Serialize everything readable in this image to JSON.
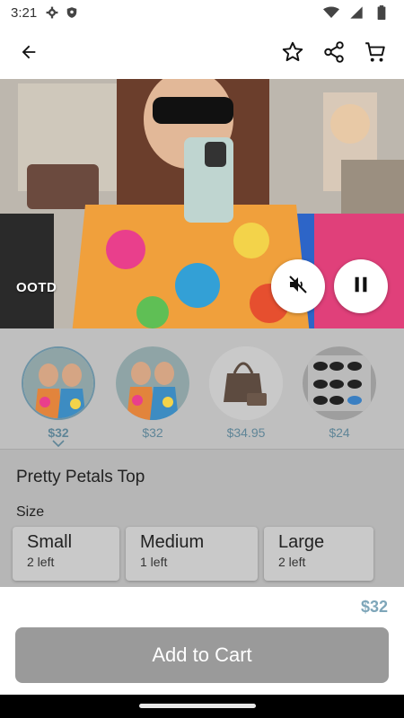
{
  "status_bar": {
    "time": "3:21"
  },
  "icons": {
    "back": "arrow-left-icon",
    "favorite": "star-outline-icon",
    "share": "share-icon",
    "cart": "cart-icon",
    "mute": "volume-off-icon",
    "pause": "pause-icon"
  },
  "video": {
    "tag": "OOTD"
  },
  "products": [
    {
      "price": "$32",
      "image": "two-women-colorful-tops",
      "selected": true
    },
    {
      "price": "$32",
      "image": "two-women-colorful-tops",
      "selected": false
    },
    {
      "price": "$34.95",
      "image": "brown-handbag-set",
      "selected": false
    },
    {
      "price": "$24",
      "image": "sunglasses-display",
      "selected": false
    }
  ],
  "product": {
    "title": "Pretty Petals Top",
    "size_label": "Size",
    "sizes": [
      {
        "name": "Small",
        "stock": "2 left"
      },
      {
        "name": "Medium",
        "stock": "1 left"
      },
      {
        "name": "Large",
        "stock": "2 left"
      }
    ],
    "price": "$32",
    "add_to_cart": "Add to Cart"
  },
  "colors": {
    "accent": "#7ea6b9",
    "button": "#9a9a9a"
  }
}
